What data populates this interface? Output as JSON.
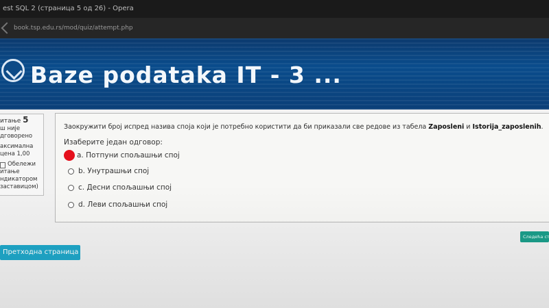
{
  "window": {
    "title": "est SQL 2 (страница 5 од 26) - Opera",
    "url": "book.tsp.edu.rs/mod/quiz/attempt.php"
  },
  "banner": {
    "course_title": "Baze podataka IT - 3 ..."
  },
  "info": {
    "question_label": "итање",
    "question_number": "5",
    "status": [
      "ш није",
      "дговорено"
    ],
    "max_grade": [
      "аксимална",
      "цена 1,00"
    ],
    "flag_text": [
      "Обележи",
      "итање",
      "ндикатором",
      "заставицом)"
    ]
  },
  "question": {
    "text_before": "Заокружити број испред назива споја који је потребно користити да би приказали све редове из табела ",
    "table1": "Zaposleni",
    "conj": " и ",
    "table2": "Istorija_zaposlenih",
    "text_after": ".",
    "prompt": "Изаберите један одговор:",
    "options": [
      "a. Потпуни спољашњи спој",
      "b. Унутрашњи спој",
      "c. Десни спољашњи спој",
      "d. Леви спољашњи спој"
    ]
  },
  "buttons": {
    "previous": "Претходна страница",
    "next": "Следећа ст"
  },
  "colors": {
    "banner": "#0a4c8c",
    "prev_button": "#1ea7c9",
    "next_button": "#1b9e8a",
    "mark": "#e5101c"
  }
}
